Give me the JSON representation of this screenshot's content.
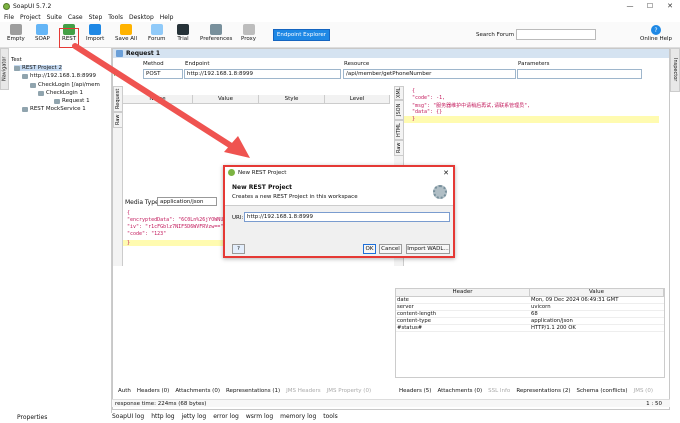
{
  "window": {
    "title": "SoapUI 5.7.2",
    "controls": [
      "—",
      "☐",
      "✕"
    ]
  },
  "menu": [
    "File",
    "Project",
    "Suite",
    "Case",
    "Step",
    "Tools",
    "Desktop",
    "Help"
  ],
  "toolbar": {
    "buttons": [
      {
        "label": "Empty",
        "color": "#9e9e9e"
      },
      {
        "label": "SOAP",
        "color": "#64b5f6"
      },
      {
        "label": "REST",
        "color": "#43a047"
      },
      {
        "label": "Import",
        "color": "#1e88e5"
      },
      {
        "label": "Save All",
        "color": "#ffb300"
      },
      {
        "label": "Forum",
        "color": "#90caf9"
      },
      {
        "label": "Trial",
        "color": "#263238"
      },
      {
        "label": "Preferences",
        "color": "#78909c"
      },
      {
        "label": "Proxy",
        "color": "#bdbdbd"
      }
    ],
    "endpoint_explorer": "Endpoint Explorer",
    "search_label": "Search Forum",
    "search_value": "",
    "help_label": "Online Help",
    "help_icon": "?"
  },
  "navigator": {
    "tab": "Navigator",
    "workspace": "Test",
    "tree": [
      {
        "label": "REST Project 2",
        "level": 0
      },
      {
        "label": "http://192.168.1.8:8999",
        "level": 1
      },
      {
        "label": "CheckLogin [/api/mem",
        "level": 2
      },
      {
        "label": "CheckLogin 1",
        "level": 3
      },
      {
        "label": "Request 1",
        "level": 4
      },
      {
        "label": "REST MockService 1",
        "level": 1
      }
    ],
    "properties_label": "Properties"
  },
  "inspector_tab": "Inspector",
  "request": {
    "title": "Request 1",
    "method_label": "Method",
    "method": "POST",
    "endpoint_label": "Endpoint",
    "endpoint": "http://192.168.1.8:8999",
    "resource_label": "Resource",
    "resource": "/api/member/getPhoneNumber",
    "parameters_label": "Parameters",
    "param_columns": [
      "Name",
      "Value",
      "Style",
      "Level"
    ],
    "side_tabs": [
      "Request",
      "Raw"
    ],
    "media_type_label": "Media Type",
    "media_type": "application/json",
    "body": [
      "{",
      "  \"encryptedData\": \"6C0Ln%26jYOWNUSA4",
      "  \"iv\": \"r1cFGblz7NIF5D6WVFRVzw==\",",
      "  \"code\": \"123\"",
      "}"
    ],
    "bottom_tabs": [
      {
        "label": "Auth",
        "dim": false
      },
      {
        "label": "Headers (0)",
        "dim": false
      },
      {
        "label": "Attachments (0)",
        "dim": false
      },
      {
        "label": "Representations (1)",
        "dim": false
      },
      {
        "label": "JMS Headers",
        "dim": true
      },
      {
        "label": "JMS Property (0)",
        "dim": true
      }
    ]
  },
  "response": {
    "side_tabs": [
      "XML",
      "JSON",
      "HTML",
      "Raw"
    ],
    "body": [
      "{",
      "   \"code\": -1,",
      "   \"msg\": \"服务器维护中请稍后再试,请联系管理员\",",
      "   \"data\": {}",
      "}"
    ],
    "headers_columns": [
      "Header",
      "Value"
    ],
    "headers": [
      {
        "h": "date",
        "v": "Mon, 09 Dec 2024 06:49:31 GMT"
      },
      {
        "h": "server",
        "v": "uvicorn"
      },
      {
        "h": "content-length",
        "v": "68"
      },
      {
        "h": "content-type",
        "v": "application/json"
      },
      {
        "h": "#status#",
        "v": "HTTP/1.1 200 OK"
      }
    ],
    "bottom_tabs": [
      {
        "label": "Headers (5)",
        "dim": false
      },
      {
        "label": "Attachments (0)",
        "dim": false
      },
      {
        "label": "SSL Info",
        "dim": true
      },
      {
        "label": "Representations (2)",
        "dim": false
      },
      {
        "label": "Schema (conflicts)",
        "dim": false
      },
      {
        "label": "JMS (0)",
        "dim": true
      }
    ]
  },
  "status": {
    "text": "response time: 224ms (68 bytes)",
    "position": "1 : 50"
  },
  "logs": [
    "SoapUI log",
    "http log",
    "jetty log",
    "error log",
    "wsrm log",
    "memory log",
    "tools"
  ],
  "dialog": {
    "title": "New REST Project",
    "heading": "New REST Project",
    "subheading": "Creates a new REST Project in this workspace",
    "uri_label": "URI:",
    "uri_value": "http://192.168.1.8:8999",
    "help": "?",
    "ok": "OK",
    "cancel": "Cancel",
    "import_wadl": "Import WADL..."
  },
  "annotation_color": "#ef5350"
}
